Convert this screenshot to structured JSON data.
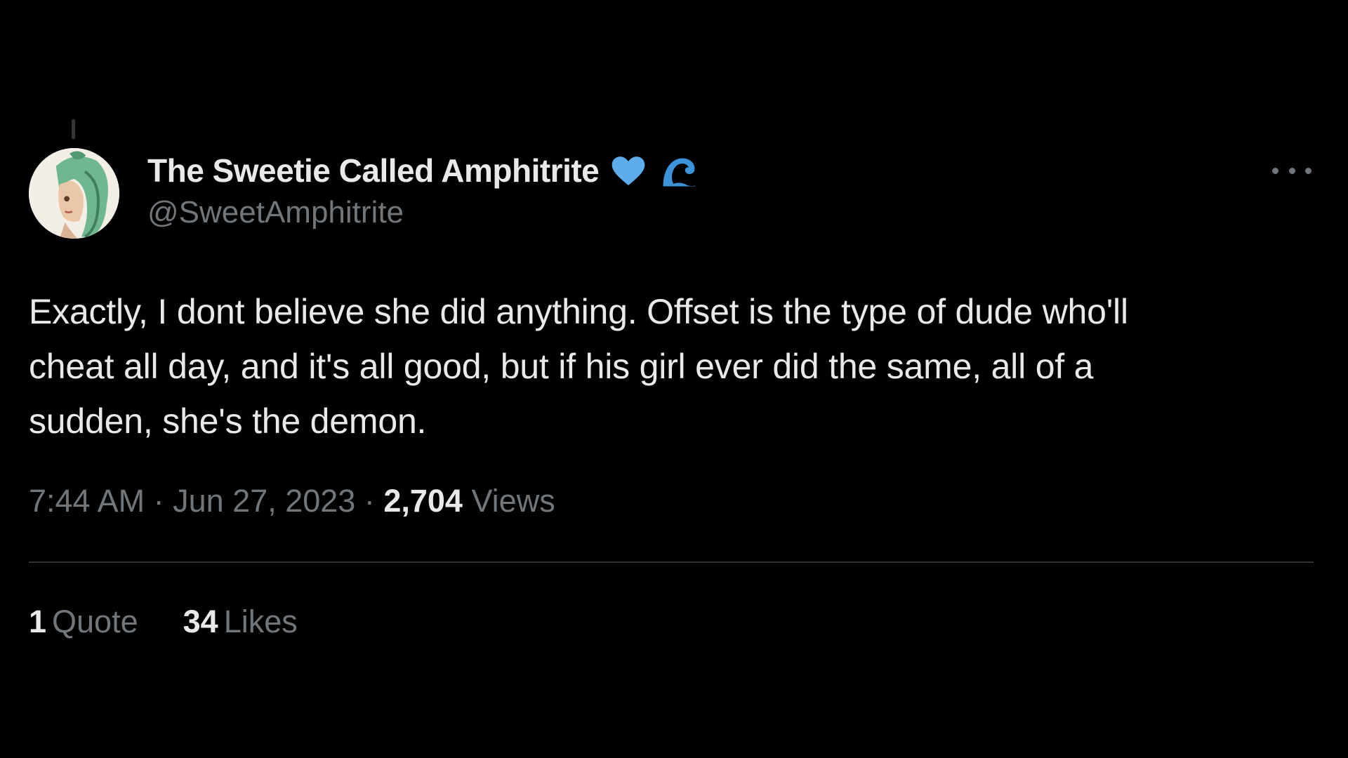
{
  "tweet": {
    "display_name": "The Sweetie Called Amphitrite",
    "name_emojis": [
      "blue-heart-icon",
      "water-wave-icon"
    ],
    "handle": "@SweetAmphitrite",
    "text": "Exactly, I dont believe she did anything. Offset is the type of dude who'll\ncheat all day, and it's all good, but if his girl ever did the same, all of a\nsudden, she's the demon.",
    "time": "7:44 AM",
    "separator": " · ",
    "date": "Jun 27, 2023",
    "views_count": "2,704",
    "views_label": " Views",
    "stats": {
      "quotes_count": "1",
      "quotes_label": "Quote",
      "likes_count": "34",
      "likes_label": "Likes"
    }
  },
  "colors": {
    "background": "#000000",
    "text_primary": "#e7e9ea",
    "text_secondary": "#71767b",
    "divider": "#2f3336",
    "accent_blue": "#4aa5f0"
  }
}
